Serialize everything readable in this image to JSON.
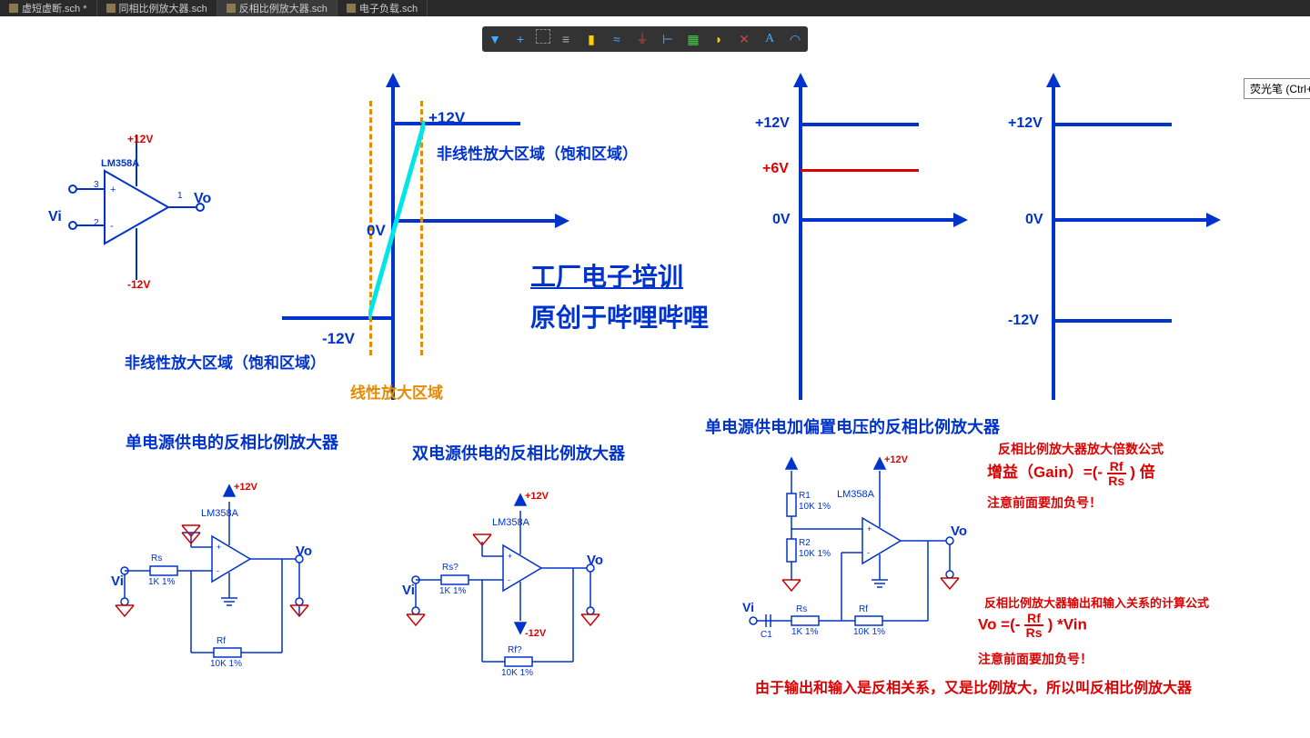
{
  "tabs": [
    {
      "label": "虚短虚断.sch *"
    },
    {
      "label": "同相比例放大器.sch"
    },
    {
      "label": "反相比例放大器.sch",
      "active": true
    },
    {
      "label": "电子负载.sch"
    }
  ],
  "tooltip": "荧光笔 (Ctrl+",
  "toolbar_icons": [
    "filter",
    "cross",
    "select",
    "align",
    "component",
    "net",
    "gnd",
    "bus",
    "panel",
    "label",
    "no-erc",
    "text",
    "arc"
  ],
  "opamp": {
    "name": "LM358A",
    "vin": "Vi",
    "vout": "Vo",
    "p12": "+12V",
    "n12": "-12V",
    "pin3": "3",
    "pin2": "2",
    "pin1": "1"
  },
  "graph1": {
    "p12": "+12V",
    "n12": "-12V",
    "zero": "0V",
    "sat_top": "非线性放大区域（饱和区域）",
    "sat_bot": "非线性放大区域（饱和区域）",
    "linear": "线性放大区域"
  },
  "center_title": "工厂电子培训",
  "center_sub": "原创于哔哩哔哩",
  "graph2": {
    "p12": "+12V",
    "p6": "+6V",
    "zero": "0V"
  },
  "graph3": {
    "p12": "+12V",
    "n12": "-12V",
    "zero": "0V"
  },
  "sec1_title": "单电源供电的反相比例放大器",
  "sec2_title": "双电源供电的反相比例放大器",
  "sec3_title": "单电源供电加偏置电压的反相比例放大器",
  "sch_common": {
    "lm": "LM358A",
    "vi": "Vi",
    "vo": "Vo",
    "p12": "+12V",
    "n12": "-12V",
    "rs": "Rs",
    "rf": "Rf",
    "val1": "1K 1%",
    "val10": "10K 1%",
    "rsq": "Rs?",
    "rfq": "Rf?",
    "r1": "R1",
    "r2": "R2",
    "c1": "C1"
  },
  "formula": {
    "title1": "反相比例放大器放大倍数公式",
    "gain_pre": "增益（Gain）=(-",
    "rf": "Rf",
    "rs": "Rs",
    "gain_post": ") 倍",
    "note1": "注意前面要加负号！",
    "title2": "反相比例放大器输出和输入关系的计算公式",
    "vo_pre": "Vo =(- ",
    "vo_post": " ) *Vin",
    "note2": "注意前面要加负号！",
    "bottom": "由于输出和输入是反相关系，又是比例放大，所以叫反相比例放大器"
  }
}
